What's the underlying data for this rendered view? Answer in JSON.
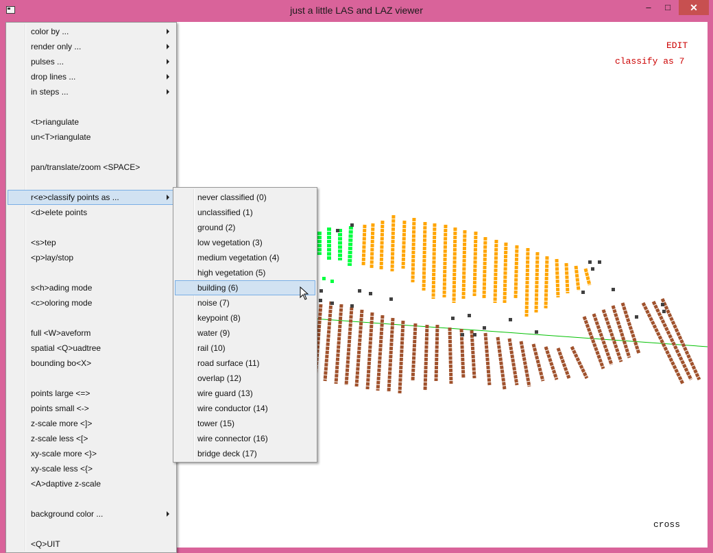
{
  "window": {
    "title": "just a little LAS and LAZ viewer",
    "minimize_label": "–",
    "maximize_label": "□",
    "close_label": "✕",
    "icon": "app-window-icon"
  },
  "overlay": {
    "mode": "EDIT",
    "action": "classify as 7",
    "cursor_mode": "cross"
  },
  "main_menu": {
    "items": [
      {
        "label": "color by ...",
        "submenu": true
      },
      {
        "label": "render only ...",
        "submenu": true
      },
      {
        "label": "pulses ...",
        "submenu": true
      },
      {
        "label": "drop lines ...",
        "submenu": true
      },
      {
        "label": "in steps ...",
        "submenu": true
      },
      {
        "label": "<t>riangulate"
      },
      {
        "label": "un<T>riangulate"
      },
      {
        "label": "pan/translate/zoom <SPACE>"
      },
      {
        "label": "r<e>classify points as ...",
        "submenu": true,
        "highlighted": true
      },
      {
        "label": "<d>elete points"
      },
      {
        "label": "<s>tep"
      },
      {
        "label": "<p>lay/stop"
      },
      {
        "label": "s<h>ading mode"
      },
      {
        "label": "<c>oloring mode"
      },
      {
        "label": "full <W>aveform"
      },
      {
        "label": "spatial <Q>uadtree"
      },
      {
        "label": "bounding bo<X>"
      },
      {
        "label": "points large <=>"
      },
      {
        "label": "points small <->"
      },
      {
        "label": "z-scale more <]>"
      },
      {
        "label": "z-scale less <[>"
      },
      {
        "label": "xy-scale more <}>"
      },
      {
        "label": "xy-scale less <{>"
      },
      {
        "label": "<A>daptive z-scale"
      },
      {
        "label": "background color ...",
        "submenu": true
      },
      {
        "label": "<Q>UIT"
      }
    ]
  },
  "classify_submenu": {
    "items": [
      {
        "label": "never classified (0)"
      },
      {
        "label": "unclassified (1)"
      },
      {
        "label": "ground (2)"
      },
      {
        "label": "low vegetation (3)"
      },
      {
        "label": "medium vegetation (4)"
      },
      {
        "label": "high vegetation (5)"
      },
      {
        "label": "building (6)",
        "highlighted": true
      },
      {
        "label": "noise (7)"
      },
      {
        "label": "keypoint (8)"
      },
      {
        "label": "water (9)"
      },
      {
        "label": "rail (10)"
      },
      {
        "label": "road surface (11)"
      },
      {
        "label": "overlap (12)"
      },
      {
        "label": "wire guard (13)"
      },
      {
        "label": "wire conductor (14)"
      },
      {
        "label": "tower (15)"
      },
      {
        "label": "wire connector (16)"
      },
      {
        "label": "bridge deck (17)"
      }
    ]
  },
  "colors": {
    "window_frame": "#d9639a",
    "close_button": "#c75050",
    "hud_text": "#cc0000",
    "ground_points": "#a0522d",
    "building_points": "#ffa500",
    "vegetation_points": "#00ff40",
    "unclassified_points": "#404040",
    "axis_line": "#00c000",
    "menu_highlight": "#d1e2f2"
  }
}
